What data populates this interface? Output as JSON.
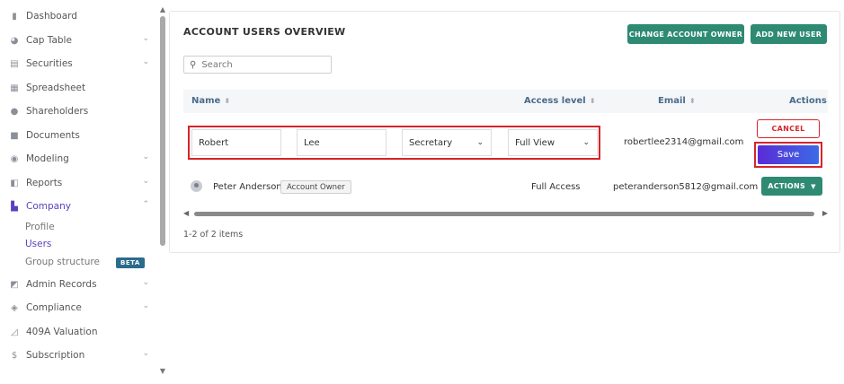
{
  "sidebar": {
    "items": [
      {
        "label": "Dashboard",
        "icon": "dashboard-icon",
        "glyph": "▮",
        "chevron": false
      },
      {
        "label": "Cap Table",
        "icon": "pie-chart-icon",
        "glyph": "◕",
        "chevron": true
      },
      {
        "label": "Securities",
        "icon": "clipboard-icon",
        "glyph": "▤",
        "chevron": true
      },
      {
        "label": "Spreadsheet",
        "icon": "spreadsheet-icon",
        "glyph": "▦",
        "chevron": false
      },
      {
        "label": "Shareholders",
        "icon": "person-icon",
        "glyph": "●",
        "chevron": false
      },
      {
        "label": "Documents",
        "icon": "folder-icon",
        "glyph": "■",
        "chevron": false
      },
      {
        "label": "Modeling",
        "icon": "lightbulb-icon",
        "glyph": "◉",
        "chevron": true
      },
      {
        "label": "Reports",
        "icon": "report-icon",
        "glyph": "◧",
        "chevron": true
      },
      {
        "label": "Company",
        "icon": "building-icon",
        "glyph": "▙",
        "chevron": true,
        "active": true
      },
      {
        "label": "Admin Records",
        "icon": "records-icon",
        "glyph": "◩",
        "chevron": true
      },
      {
        "label": "Compliance",
        "icon": "shield-icon",
        "glyph": "◈",
        "chevron": true
      },
      {
        "label": "409A Valuation",
        "icon": "chart-icon",
        "glyph": "◿",
        "chevron": false
      },
      {
        "label": "Subscription",
        "icon": "dollar-icon",
        "glyph": "$",
        "chevron": true
      }
    ],
    "company_sub": [
      {
        "label": "Profile"
      },
      {
        "label": "Users",
        "active": true
      },
      {
        "label": "Group structure"
      }
    ],
    "beta_label": "BETA"
  },
  "main": {
    "title": "ACCOUNT USERS OVERVIEW",
    "change_owner_label": "CHANGE ACCOUNT OWNER",
    "add_user_label": "ADD NEW USER",
    "search_placeholder": "Search",
    "columns": {
      "name": "Name",
      "access": "Access level",
      "email": "Email",
      "actions": "Actions"
    },
    "edit_row": {
      "first_name": "Robert",
      "last_name": "Lee",
      "role": "Secretary",
      "access": "Full View",
      "email": "robertlee2314@gmail.com",
      "cancel_label": "CANCEL",
      "save_label": "Save"
    },
    "rows": [
      {
        "name": "Peter Anderson",
        "badge": "Account Owner",
        "access": "Full Access",
        "email": "peteranderson5812@gmail.com",
        "actions_label": "ACTIONS"
      }
    ],
    "footer": "1-2 of 2 items"
  },
  "colors": {
    "accent": "#5a3fc0",
    "teal": "#2e8a73",
    "danger": "#d8232a"
  }
}
